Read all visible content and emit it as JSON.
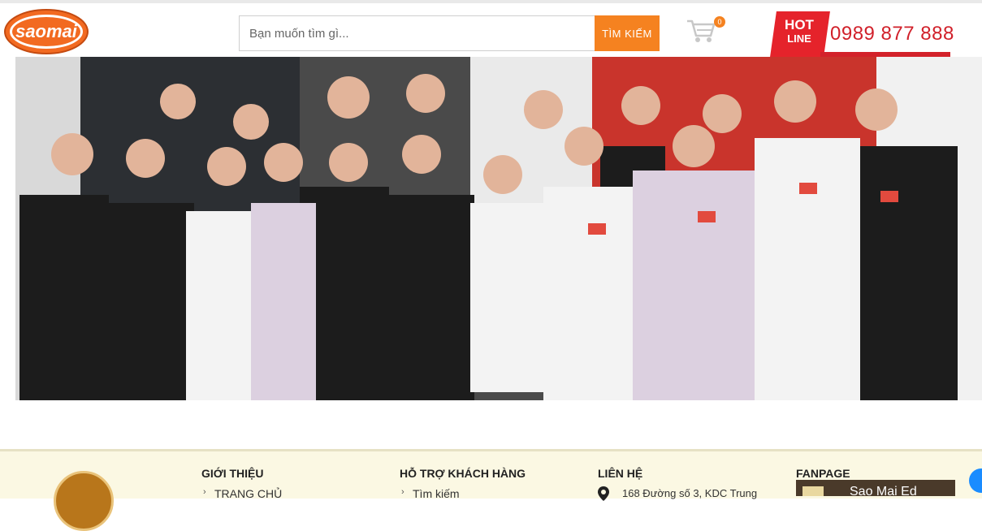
{
  "header": {
    "logo_text": "saomai",
    "search_placeholder": "Bạn muốn tìm gì...",
    "search_button": "TÌM KIẾM",
    "cart_count": "0",
    "hotline_label_1": "HOT",
    "hotline_label_2": "LINE",
    "hotline_number": "0989 877 888"
  },
  "hero": {
    "alt": "Sao Mai team photo"
  },
  "footer": {
    "col1": {
      "title": "GIỚI THIỆU",
      "link": "TRANG CHỦ"
    },
    "col2": {
      "title": "HỖ TRỢ KHÁCH HÀNG",
      "link": "Tìm kiếm"
    },
    "col3": {
      "title": "LIÊN HỆ",
      "address": "168 Đường số 3, KDC Trung"
    },
    "col4": {
      "title": "FANPAGE",
      "page_name": "Sao Mai Ed"
    }
  },
  "colors": {
    "accent": "#f58220",
    "hotline_red": "#e5232b",
    "footer_bg": "#fbf8e3"
  }
}
